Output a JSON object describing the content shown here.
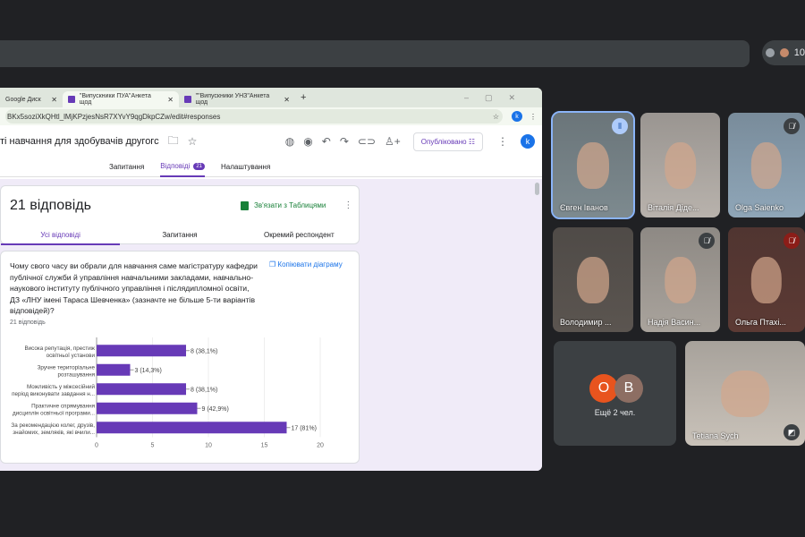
{
  "meet": {
    "participant_count": "10"
  },
  "browser": {
    "tabs": [
      {
        "label": "Google Диск"
      },
      {
        "label": "\"Випускники ПУА\"Анкета щод"
      },
      {
        "label": "\"\"Випускники УНЗ\"Анкета щод"
      }
    ],
    "new_tab": "+",
    "url": "BKx5soziXkQHtl_lMjKPzjesNsR7XYvY9qgDkpCZw/edit#responses",
    "account_initial": "k"
  },
  "form": {
    "title": "ті навчання для здобувачів другогс",
    "publish_label": "Опубліковано",
    "tabs": {
      "questions": "Запитання",
      "responses": "Відповіді",
      "responses_count": "21",
      "settings": "Налаштування"
    },
    "summary": {
      "heading": "21 відповідь",
      "link_sheets": "Зв'язати з Таблицями",
      "tabs": [
        "Усі відповіді",
        "Запитання",
        "Окремий респондент"
      ]
    },
    "question": {
      "text": "Чому свого часу ви обрали для навчання саме магістратуру кафедри публічної служби й управління навчальними закладами, навчально-наукового інституту публічного управління і післядипломної освіти, ДЗ «ЛНУ імені Тараса Шевченка» (зазначте не більше 5-ти варіантів відповідей)?",
      "response_count": "21 відповідь",
      "copy_chart": "Копіювати діаграму"
    }
  },
  "chart_data": {
    "type": "bar",
    "orientation": "horizontal",
    "categories": [
      [
        "Висока репутація, престиж",
        "освітньої установи"
      ],
      [
        "Зручне територіальне",
        "розташування"
      ],
      [
        "Можливість у міжсесійний",
        "період виконувати завдання н..."
      ],
      [
        "Практичне спрямування",
        "дисциплін освітньої програми..."
      ],
      [
        "За рекомендацією колег, друзів,",
        "знайомих, земляків, які вчили..."
      ]
    ],
    "values": [
      8,
      3,
      8,
      9,
      17
    ],
    "labels": [
      "8 (38,1%)",
      "3 (14,3%)",
      "8 (38,1%)",
      "9 (42,9%)",
      "17 (81%)"
    ],
    "xlim": [
      0,
      20
    ],
    "xticks": [
      "0",
      "5",
      "10",
      "15",
      "20"
    ],
    "color": "#673ab7",
    "grid": true
  },
  "participants": [
    {
      "name": "Євген Іванов",
      "status": "speaking",
      "bg": "#7d8a8f"
    },
    {
      "name": "Віталія Діде...",
      "status": "",
      "bg": "#b8b2ac"
    },
    {
      "name": "Olga Saienko",
      "status": "muted",
      "bg": "#8fa6b8"
    },
    {
      "name": "Володимир ...",
      "status": "",
      "bg": "#5b5550"
    },
    {
      "name": "Надія Васин...",
      "status": "muted",
      "bg": "#a9a39c"
    },
    {
      "name": "Ольга Птахі...",
      "status": "muted",
      "bg": "#5c3a34"
    },
    {
      "name": "Tetiana Sych",
      "status": "",
      "bg": "#c9c2b9"
    }
  ],
  "more": {
    "label": "Ещё 2 чел.",
    "avatars": [
      {
        "initial": "O",
        "color": "#e8541e"
      },
      {
        "initial": "B",
        "color": "#8d6e63"
      }
    ]
  }
}
